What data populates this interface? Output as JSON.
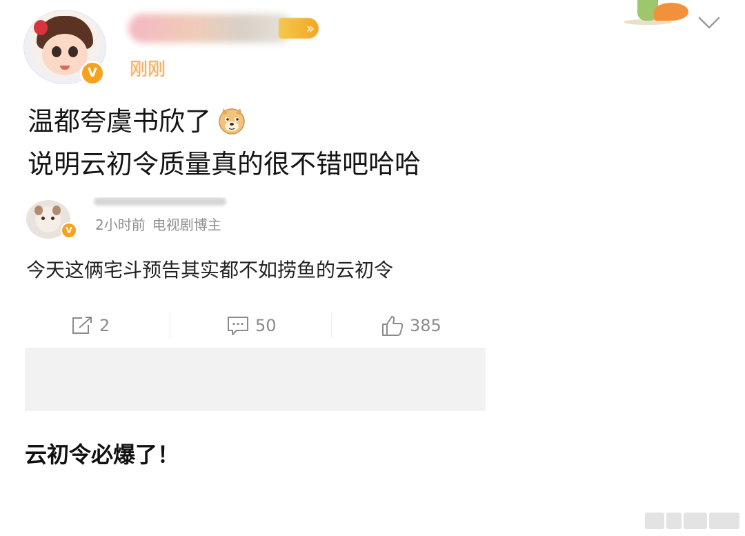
{
  "post": {
    "time": "刚刚",
    "text_line1": "温都夸虞书欣了",
    "text_line2": "说明云初令质量真的很不错吧哈哈"
  },
  "embedded": {
    "time": "2小时前",
    "tag": "电视剧博主",
    "text": "今天这俩宅斗预告其实都不如捞鱼的云初令",
    "actions": {
      "repost_count": "2",
      "comment_count": "50",
      "like_count": "385"
    },
    "next_text": "云初令必爆了！"
  },
  "colors": {
    "verified_badge": "#f6a21c",
    "time_text": "#f39a34",
    "action_grey": "#8a8a8a"
  },
  "icons": {
    "verified": "v-verified-icon",
    "emoji": "doge-emoji",
    "repost": "repost-icon",
    "comment": "comment-icon",
    "like": "like-icon",
    "menu": "chevron-down-icon"
  }
}
